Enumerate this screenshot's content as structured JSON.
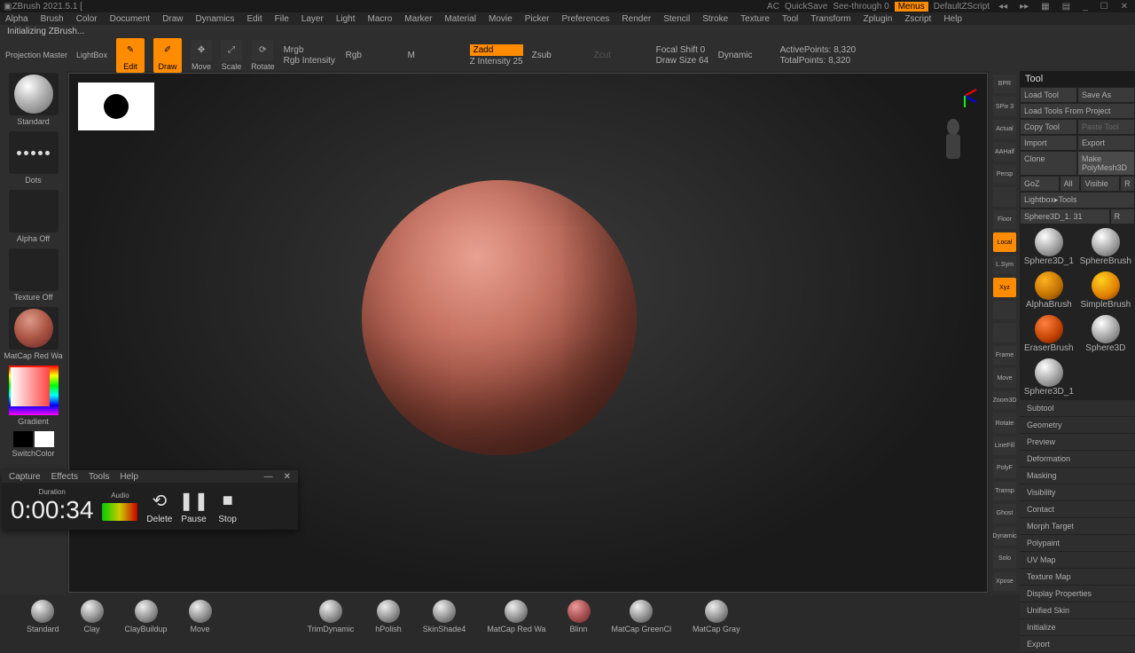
{
  "app_title": "ZBrush 2021.5.1 [",
  "top_right": {
    "ac": "AC",
    "quicksave": "QuickSave",
    "see": "See-through 0",
    "menus": "Menus",
    "script": "DefaultZScript"
  },
  "menu": [
    "Alpha",
    "Brush",
    "Color",
    "Document",
    "Draw",
    "Dynamics",
    "Edit",
    "File",
    "Layer",
    "Light",
    "Macro",
    "Marker",
    "Material",
    "Movie",
    "Picker",
    "Preferences",
    "Render",
    "Stencil",
    "Stroke",
    "Texture",
    "Tool",
    "Transform",
    "Zplugin",
    "Zscript",
    "Help"
  ],
  "status": "Initializing ZBrush...",
  "toolbar": {
    "projection": "Projection Master",
    "lightbox": "LightBox",
    "edit": "Edit",
    "draw": "Draw",
    "move": "Move",
    "scale": "Scale",
    "rotate": "Rotate",
    "mrgb": "Mrgb",
    "rgb": "Rgb",
    "m": "M",
    "rgb_int": "Rgb Intensity",
    "zadd": "Zadd",
    "zsub": "Zsub",
    "zcut": "Zcut",
    "zint": "Z Intensity 25",
    "focal": "Focal Shift 0",
    "drawsize": "Draw Size 64",
    "dynamic": "Dynamic",
    "active": "ActivePoints: 8,320",
    "total": "TotalPoints: 8,320"
  },
  "left": {
    "standard": "Standard",
    "dots": "Dots",
    "alpha": "Alpha Off",
    "texture": "Texture Off",
    "material": "MatCap Red Wa",
    "gradient": "Gradient",
    "switch": "SwitchColor"
  },
  "rstrip": [
    "BPR",
    "SPix 3",
    "Actual",
    "AAHalf",
    "Persp",
    "",
    "Floor",
    "Local",
    "L.Sym",
    "Xyz",
    "",
    "",
    "Frame",
    "Move",
    "Zoom3D",
    "Rotate",
    "LineFill",
    "PolyF",
    "Transp",
    "Ghost",
    "Dynamic",
    "Solo",
    "Xpose"
  ],
  "tool": {
    "header": "Tool",
    "load": "Load Tool",
    "save": "Save As",
    "loadproj": "Load Tools From Project",
    "copy": "Copy Tool",
    "paste": "Paste Tool",
    "import": "Import",
    "export": "Export",
    "clone": "Clone",
    "make": "Make PolyMesh3D",
    "goz": "GoZ",
    "all": "All",
    "visible": "Visible",
    "r": "R",
    "lightbox": "Lightbox▸Tools",
    "current": "Sphere3D_1. 31",
    "items": [
      "Sphere3D_1",
      "SphereBrush",
      "AlphaBrush",
      "SimpleBrush",
      "EraserBrush",
      "Sphere3D",
      "Sphere3D_1"
    ],
    "sections": [
      "Subtool",
      "Geometry",
      "Preview",
      "Deformation",
      "Masking",
      "Visibility",
      "Contact",
      "Morph Target",
      "Polypaint",
      "UV Map",
      "Texture Map",
      "Display Properties",
      "Unified Skin",
      "Initialize",
      "Export"
    ]
  },
  "brushes": [
    "Standard",
    "Clay",
    "ClayBuildup",
    "Move",
    "TrimDynamic",
    "hPolish",
    "SkinShade4",
    "MatCap Red Wa",
    "Blinn",
    "MatCap GreenCl",
    "MatCap Gray"
  ],
  "recorder": {
    "menu": [
      "Capture",
      "Effects",
      "Tools",
      "Help"
    ],
    "duration_label": "Duration",
    "audio_label": "Audio",
    "time": "0:00:34",
    "delete": "Delete",
    "pause": "Pause",
    "stop": "Stop"
  }
}
